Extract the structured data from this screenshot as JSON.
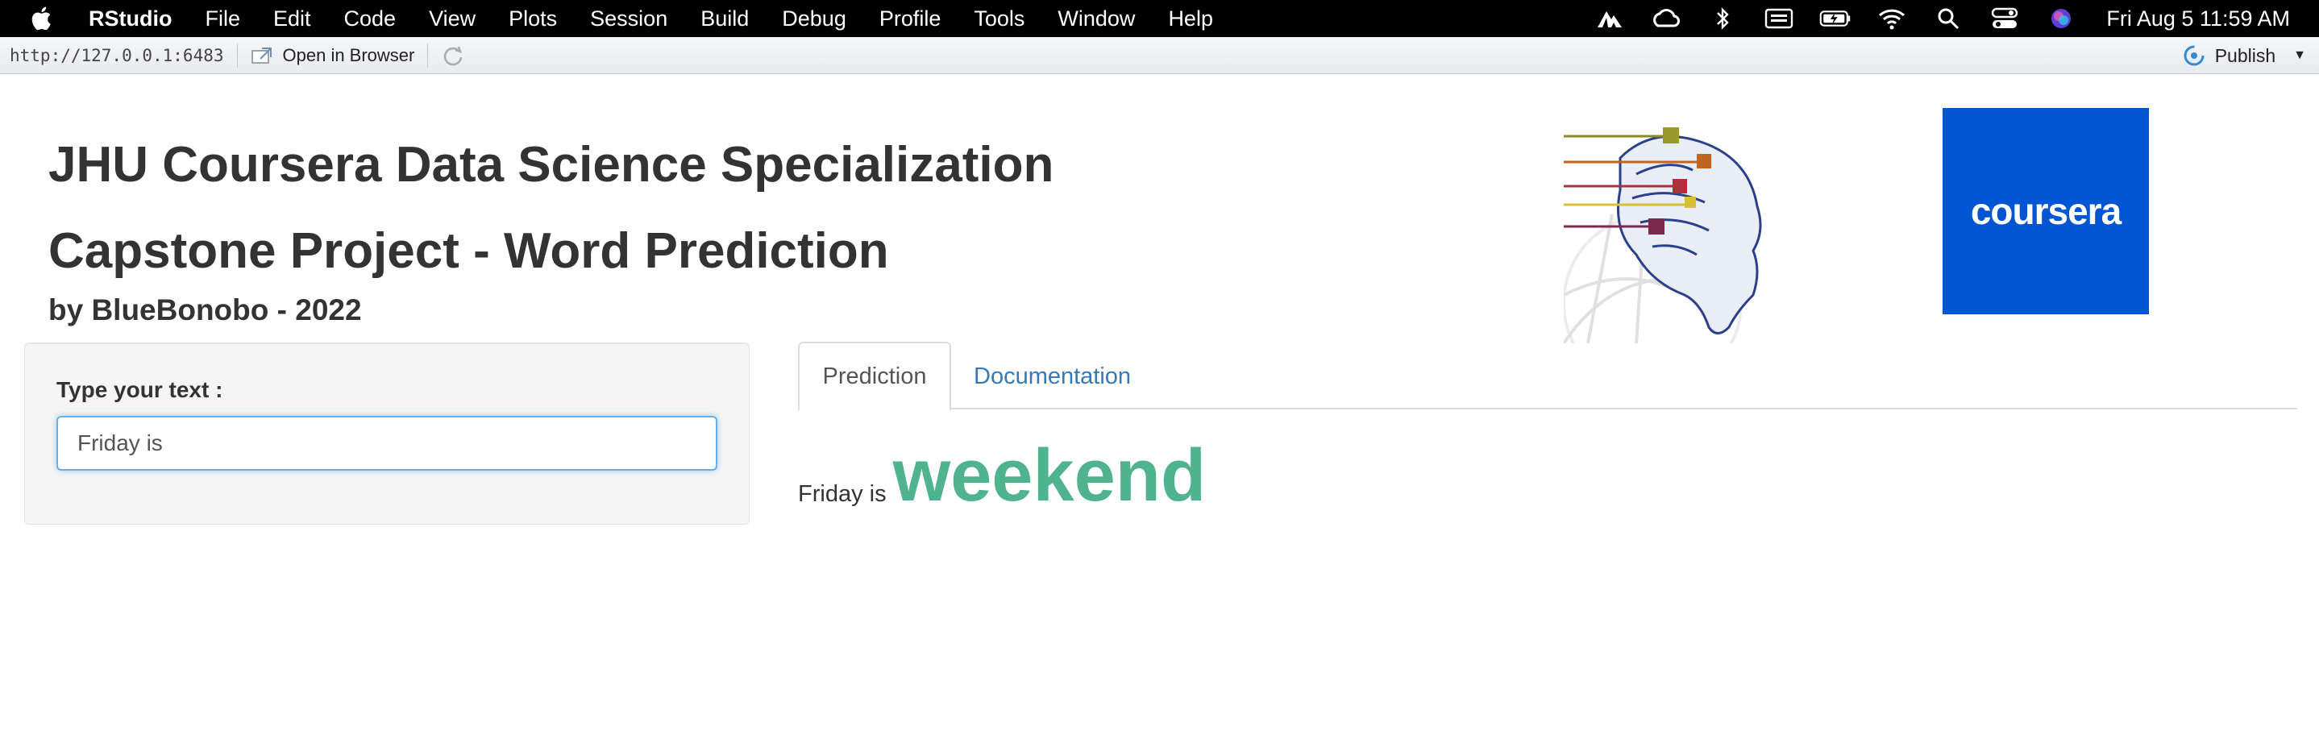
{
  "menubar": {
    "app_name": "RStudio",
    "items": [
      "File",
      "Edit",
      "Code",
      "View",
      "Plots",
      "Session",
      "Build",
      "Debug",
      "Profile",
      "Tools",
      "Window",
      "Help"
    ],
    "clock": "Fri Aug 5  11:59 AM",
    "status_icons": [
      "nordvpn-icon",
      "creative-cloud-icon",
      "bluetooth-icon",
      "keyboard-icon",
      "battery-icon",
      "wifi-icon",
      "spotlight-search-icon",
      "control-center-icon",
      "siri-icon"
    ]
  },
  "toolbar": {
    "url": "http://127.0.0.1:6483",
    "open_in_browser": "Open in Browser",
    "publish": "Publish"
  },
  "app": {
    "title_line1": "JHU Coursera Data Science Specialization",
    "title_line2": "Capstone Project - Word Prediction",
    "subtitle": "by BlueBonobo - 2022",
    "coursera_logo_text": "coursera",
    "input_label": "Type your text :",
    "input_value": "Friday is",
    "tabs": [
      {
        "label": "Prediction",
        "active": true
      },
      {
        "label": "Documentation",
        "active": false
      }
    ],
    "prediction": {
      "input_echo": "Friday is",
      "predicted_word": "weekend"
    }
  },
  "colors": {
    "menubar_bg": "#000000",
    "coursera_blue": "#0056d2",
    "prediction_green": "#4fb38f",
    "tab_link_blue": "#337ab7",
    "input_focus_blue": "#66afe9"
  }
}
